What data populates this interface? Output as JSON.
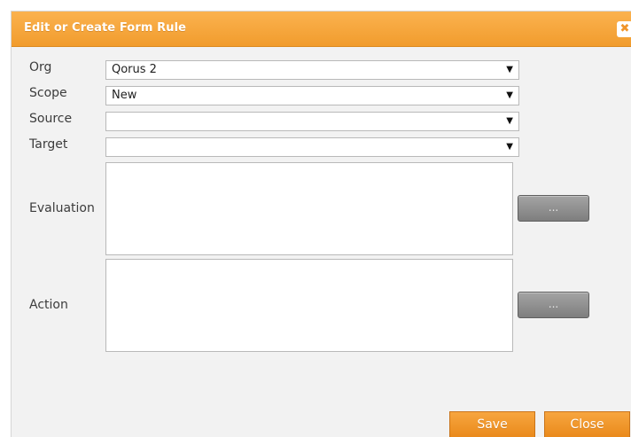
{
  "dialog": {
    "title": "Edit or Create Form Rule",
    "close_glyph": "✖"
  },
  "form": {
    "org": {
      "label": "Org",
      "value": "Qorus 2"
    },
    "scope": {
      "label": "Scope",
      "value": "New"
    },
    "source": {
      "label": "Source",
      "value": ""
    },
    "target": {
      "label": "Target",
      "value": ""
    },
    "evaluation": {
      "label": "Evaluation",
      "value": "",
      "button_label": "..."
    },
    "action": {
      "label": "Action",
      "value": "",
      "button_label": "..."
    },
    "dropdown_arrow": "▼"
  },
  "footer": {
    "save_label": "Save",
    "close_label": "Close"
  },
  "colors": {
    "title_bar": "#f19c2d",
    "button_orange": "#ef9323",
    "ellipsis_button": "#8f8f8f",
    "dialog_background": "#f2f2f2"
  }
}
